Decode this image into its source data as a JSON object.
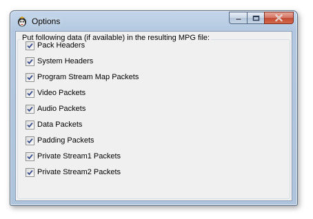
{
  "window": {
    "title": "Options",
    "icon": "app-mascot-icon"
  },
  "caption_buttons": {
    "minimize": "minimize-icon",
    "maximize": "maximize-icon",
    "close": "close-icon"
  },
  "group": {
    "title": "Put following data (if available) in the resulting MPG file:"
  },
  "options": [
    {
      "label": "Pack Headers",
      "checked": true
    },
    {
      "label": "System Headers",
      "checked": true
    },
    {
      "label": "Program Stream Map Packets",
      "checked": true
    },
    {
      "label": "Video Packets",
      "checked": true
    },
    {
      "label": "Audio Packets",
      "checked": true
    },
    {
      "label": "Data Packets",
      "checked": true
    },
    {
      "label": "Padding Packets",
      "checked": true
    },
    {
      "label": "Private Stream1 Packets",
      "checked": true
    },
    {
      "label": "Private Stream2 Packets",
      "checked": true
    }
  ],
  "colors": {
    "check_mark": "#3c4d8a",
    "frame": "#b3c8e0",
    "client_bg": "#f0f0f0"
  }
}
